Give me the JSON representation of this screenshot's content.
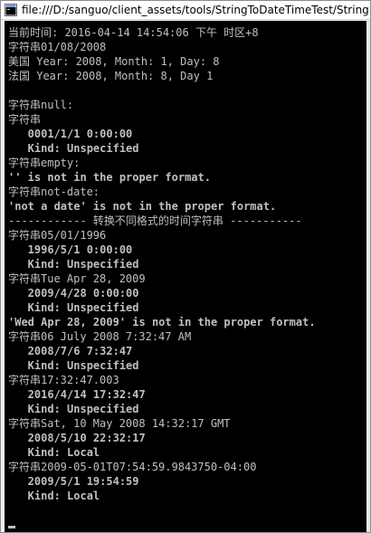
{
  "window": {
    "title": "file:///D:/sanguo/client_assets/tools/StringToDateTimeTest/String",
    "icon": "console-app-icon"
  },
  "console": {
    "lines": [
      "当前时间: 2016-04-14 14:54:06 下午 时区+8",
      "字符串01/08/2008",
      "美国 Year: 2008, Month: 1, Day: 8",
      "法国 Year: 2008, Month: 8, Day 1",
      "",
      "字符串null:",
      "字符串",
      "   0001/1/1 0:00:00",
      "   Kind: Unspecified",
      "字符串empty:",
      "'' is not in the proper format.",
      "字符串not-date:",
      "'not a date' is not in the proper format.",
      "------------ 转换不同格式的时间字符串 -----------",
      "字符串05/01/1996",
      "   1996/5/1 0:00:00",
      "   Kind: Unspecified",
      "字符串Tue Apr 28, 2009",
      "   2009/4/28 0:00:00",
      "   Kind: Unspecified",
      "'Wed Apr 28, 2009' is not in the proper format.",
      "字符串06 July 2008 7:32:47 AM",
      "   2008/7/6 7:32:47",
      "   Kind: Unspecified",
      "字符串17:32:47.003",
      "   2016/4/14 17:32:47",
      "   Kind: Unspecified",
      "字符串Sat, 10 May 2008 14:32:17 GMT",
      "   2008/5/10 22:32:17",
      "   Kind: Local",
      "字符串2009-05-01T07:54:59.9843750-04:00",
      "   2009/5/1 19:54:59",
      "   Kind: Local",
      ""
    ]
  },
  "colors": {
    "console_bg": "#000000",
    "console_text": "#c0c0c0",
    "titlebar_bg": "#ffffff"
  }
}
